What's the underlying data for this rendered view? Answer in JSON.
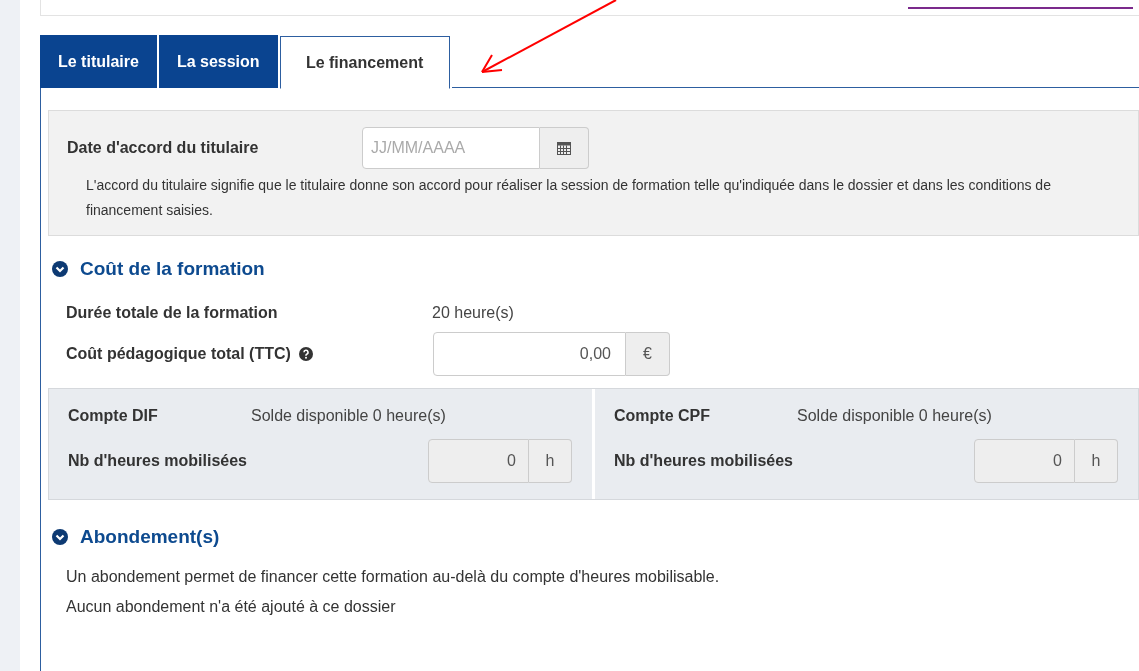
{
  "tabs": [
    {
      "label": "Le titulaire",
      "selected": false
    },
    {
      "label": "La session",
      "selected": false
    },
    {
      "label": "Le financement",
      "selected": true
    }
  ],
  "agreement": {
    "label": "Date d'accord du titulaire",
    "placeholder": "JJ/MM/AAAA",
    "help": "L'accord du titulaire signifie que le titulaire donne son accord pour réaliser la session de formation telle qu'indiquée dans le dossier et dans les conditions de financement saisies."
  },
  "cost_section": {
    "title": "Coût de la formation",
    "duration_label": "Durée totale de la formation",
    "duration_value": "20 heure(s)",
    "cost_label": "Coût pédagogique total (TTC)",
    "cost_value": "0,00",
    "cost_unit": "€"
  },
  "accounts": [
    {
      "name": "Compte DIF",
      "balance": "Solde disponible 0 heure(s)",
      "hours_label": "Nb d'heures mobilisées",
      "hours_value": "0",
      "unit": "h",
      "disabled": true
    },
    {
      "name": "Compte CPF",
      "balance": "Solde disponible 0 heure(s)",
      "hours_label": "Nb d'heures mobilisées",
      "hours_value": "0",
      "unit": "h",
      "disabled": true
    }
  ],
  "abondement_section": {
    "title": "Abondement(s)",
    "lines": [
      "Un abondement permet de financer cette formation au-delà du compte d'heures mobilisable.",
      "Aucun abondement n'a été ajouté à ce dossier"
    ]
  }
}
